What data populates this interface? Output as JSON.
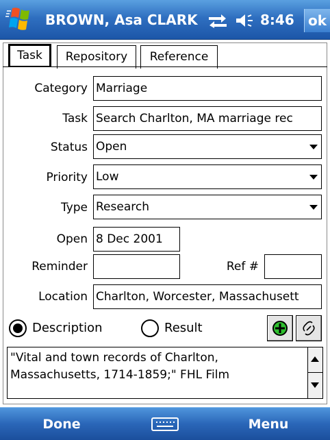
{
  "titlebar": {
    "title": "BROWN, Asa CLARK",
    "time": "8:46",
    "ok_label": "ok",
    "icons": [
      "windows-start-icon",
      "connectivity-icon",
      "volume-icon"
    ]
  },
  "tabs": [
    {
      "label": "Task",
      "active": true
    },
    {
      "label": "Repository",
      "active": false
    },
    {
      "label": "Reference",
      "active": false
    }
  ],
  "form": {
    "category": {
      "label": "Category",
      "value": "Marriage"
    },
    "task": {
      "label": "Task",
      "value": "Search Charlton, MA marriage rec"
    },
    "status": {
      "label": "Status",
      "value": "Open"
    },
    "priority": {
      "label": "Priority",
      "value": "Low"
    },
    "type": {
      "label": "Type",
      "value": "Research"
    },
    "open": {
      "label": "Open",
      "value": "8 Dec 2001"
    },
    "reminder": {
      "label": "Reminder",
      "value": ""
    },
    "ref": {
      "label": "Ref #",
      "value": ""
    },
    "location": {
      "label": "Location",
      "value": "Charlton, Worcester, Massachusett"
    }
  },
  "radios": {
    "description_label": "Description",
    "result_label": "Result",
    "selected": "Description"
  },
  "notes": {
    "text": "\"Vital and town records of Charlton,\nMassachusetts, 1714-1859;\" FHL Film"
  },
  "softkeys": {
    "left": "Done",
    "right": "Menu"
  },
  "colors": {
    "bar_top": "#5aa0e0",
    "bar_bottom": "#1c56a8",
    "add_icon_green": "#2fbf2f"
  }
}
